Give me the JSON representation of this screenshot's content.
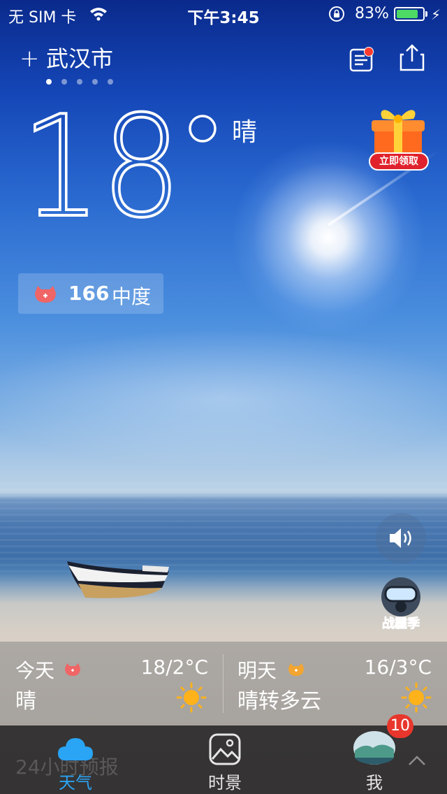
{
  "status_bar": {
    "carrier": "无 SIM 卡",
    "time": "下午3:45",
    "battery_pct": "83%",
    "battery_level": 0.83,
    "battery_color": "#4cd964"
  },
  "header": {
    "add_symbol": "+",
    "city": "武汉市",
    "page_count": 5,
    "active_page": 1,
    "news_icon": "news-list-icon",
    "share_icon": "share-icon"
  },
  "current": {
    "temperature": "18",
    "condition": "晴",
    "promo_label": "立即领取"
  },
  "aqi": {
    "value": "166",
    "level": "中度",
    "color": "#f06565"
  },
  "mascot_label": "战霾季",
  "forecast": {
    "today": {
      "day": "今天",
      "condition": "晴",
      "range": "18/2°C",
      "aqi_color": "#f06565"
    },
    "tomorrow": {
      "day": "明天",
      "condition": "晴转多云",
      "range": "16/3°C",
      "aqi_color": "#f2a531"
    }
  },
  "tabbar": {
    "hourly_link": "24小时预报",
    "tabs": [
      {
        "label": "天气",
        "icon": "cloud-icon",
        "active": true
      },
      {
        "label": "时景",
        "icon": "photo-icon",
        "active": false
      },
      {
        "label": "我",
        "icon": "avatar-icon",
        "active": false
      }
    ],
    "me_badge": "10",
    "accent": "#2aa4f4"
  }
}
